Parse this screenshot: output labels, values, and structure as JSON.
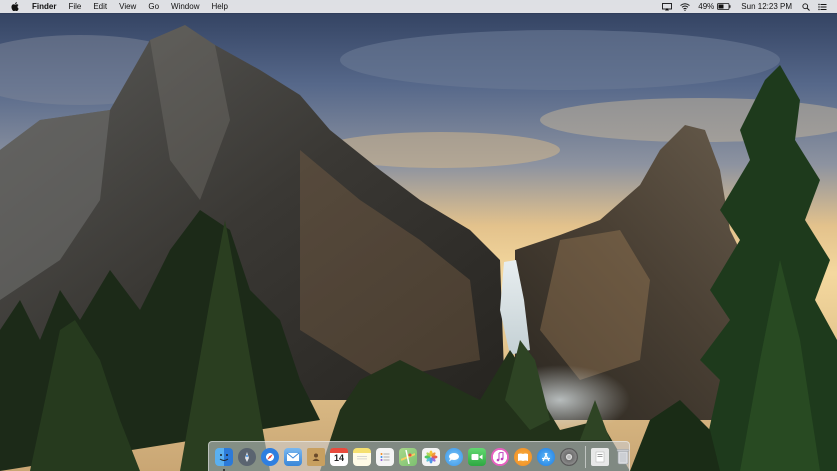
{
  "menubar": {
    "apple_icon": "apple-logo-icon",
    "app_name": "Finder",
    "menus": [
      "File",
      "Edit",
      "View",
      "Go",
      "Window",
      "Help"
    ],
    "status": {
      "airplay_icon": "airplay-icon",
      "wifi_icon": "wifi-icon",
      "battery_percent": "49%",
      "battery_icon": "battery-icon",
      "clock": "Sun 12:23 PM",
      "spotlight_icon": "search-icon",
      "notification_icon": "notification-center-icon"
    }
  },
  "dock": {
    "apps": [
      {
        "name": "Finder",
        "icon": "finder-icon",
        "color": "#3a8ee6",
        "running": true
      },
      {
        "name": "Launchpad",
        "icon": "launchpad-icon",
        "color": "#5a6470"
      },
      {
        "name": "Safari",
        "icon": "safari-icon",
        "color": "#2f7fe0"
      },
      {
        "name": "Mail",
        "icon": "mail-icon",
        "color": "#5aa0e8"
      },
      {
        "name": "Contacts",
        "icon": "contacts-icon",
        "color": "#c8a060"
      },
      {
        "name": "Calendar",
        "icon": "calendar-icon",
        "color": "#ffffff",
        "day": "14"
      },
      {
        "name": "Notes",
        "icon": "notes-icon",
        "color": "#f5e070"
      },
      {
        "name": "Reminders",
        "icon": "reminders-icon",
        "color": "#f4f4f4"
      },
      {
        "name": "Maps",
        "icon": "maps-icon",
        "color": "#7cc070"
      },
      {
        "name": "Photos",
        "icon": "photos-icon",
        "color": "#f4f4f4"
      },
      {
        "name": "Messages",
        "icon": "messages-icon",
        "color": "#4aa6f0"
      },
      {
        "name": "FaceTime",
        "icon": "facetime-icon",
        "color": "#3ec050"
      },
      {
        "name": "iTunes",
        "icon": "itunes-icon",
        "color": "#e860c0"
      },
      {
        "name": "iBooks",
        "icon": "ibooks-icon",
        "color": "#f08a20"
      },
      {
        "name": "App Store",
        "icon": "app-store-icon",
        "color": "#3a9af0"
      },
      {
        "name": "System Preferences",
        "icon": "system-preferences-icon",
        "color": "#8a8a8a"
      }
    ],
    "others": [
      {
        "name": "Downloads",
        "icon": "downloads-stack-icon",
        "color": "#e8e8e8"
      },
      {
        "name": "Trash",
        "icon": "trash-icon",
        "color": "#d8dade"
      }
    ]
  }
}
